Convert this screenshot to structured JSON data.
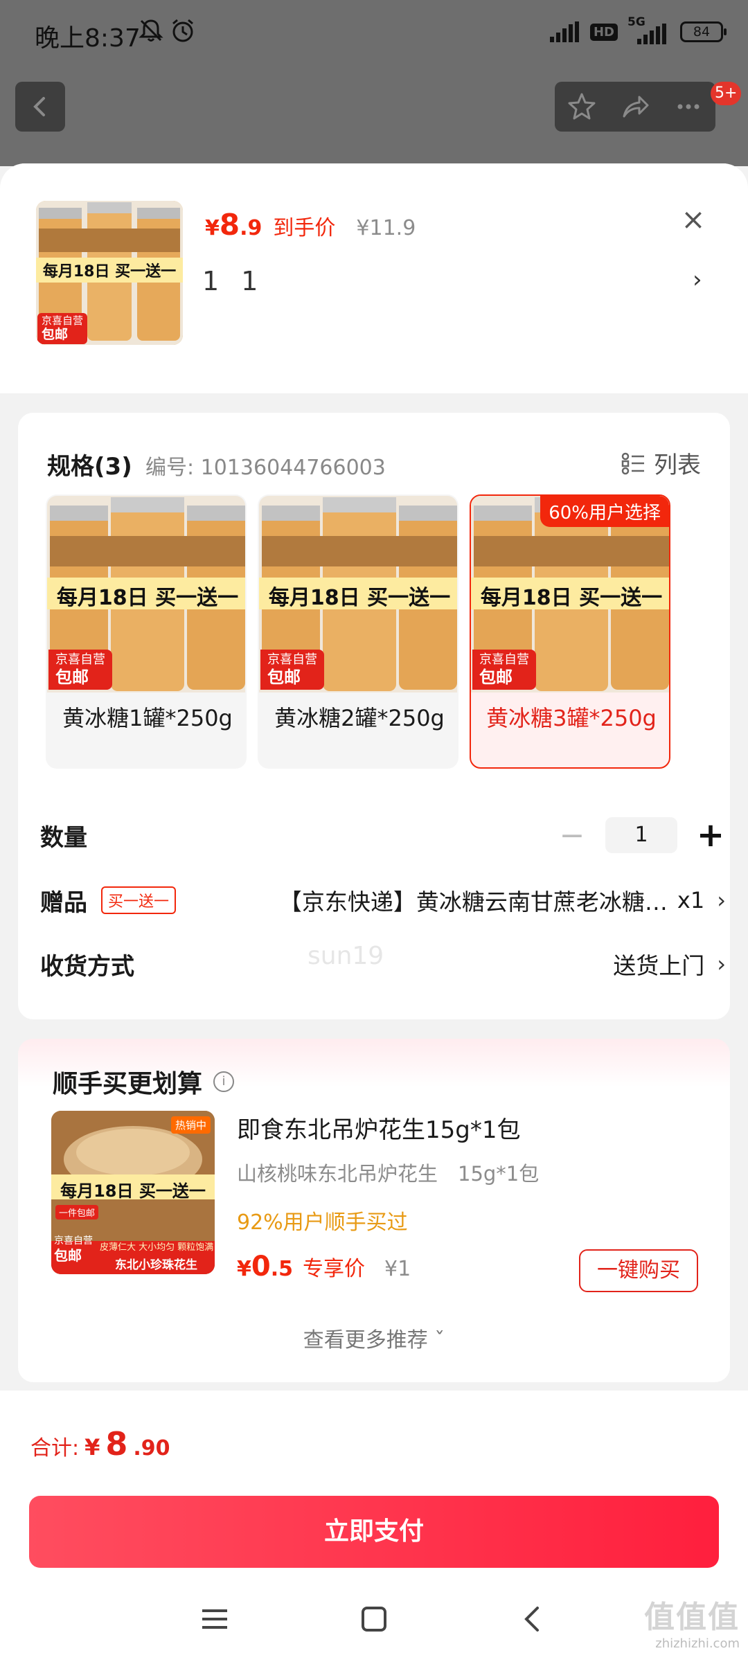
{
  "status_bar": {
    "time": "晚上8:37",
    "network": "5G",
    "hd": "HD",
    "battery": "84"
  },
  "nav": {
    "badge": "5+"
  },
  "product": {
    "currency": "¥",
    "price_int": "8",
    "price_dec": ".9",
    "price_tag": "到手价",
    "orig_price": "¥11.9",
    "selection_line": "1 1",
    "thumb_banner": "每月18日 买一送一",
    "thumb_tag1": "京喜自营",
    "thumb_tag2": "包邮"
  },
  "spec": {
    "title": "规格(3)",
    "code": "编号: 10136044766003",
    "list_label": "列表",
    "variants": [
      {
        "label": "黄冰糖1罐*250g",
        "banner": "每月18日 买一送一",
        "tag1": "京喜自营",
        "tag2": "包邮"
      },
      {
        "label": "黄冰糖2罐*250g",
        "banner": "每月18日 买一送一",
        "tag1": "京喜自营",
        "tag2": "包邮"
      },
      {
        "label": "黄冰糖3罐*250g",
        "banner": "每月18日 买一送一",
        "tag1": "京喜自营",
        "tag2": "包邮",
        "badge": "60%用户选择"
      }
    ]
  },
  "ghost_text": "sun19",
  "quantity": {
    "label": "数量",
    "minus": "−",
    "value": "1",
    "plus": "+"
  },
  "gift": {
    "label": "赠品",
    "tag": "买一送一",
    "value": "【京东快递】黄冰糖云南甘蔗老冰糖…",
    "count": "x1"
  },
  "delivery": {
    "label": "收货方式",
    "value": "送货上门"
  },
  "recommend": {
    "title": "顺手买更划算",
    "name": "即食东北吊炉花生15g*1包",
    "sub": "山核桃味东北吊炉花生　15g*1包",
    "rate": "92%用户顺手买过",
    "currency": "¥",
    "price_int": "0",
    "price_dec": ".5",
    "price_tag": "专享价",
    "orig_price": "¥1",
    "buy_label": "一键购买",
    "see_more": "查看更多推荐 ˇ",
    "img_banner": "每月18日 买一送一",
    "img_hot": "热销中",
    "img_tag1": "京喜自营",
    "img_tag2": "包邮",
    "img_caption": "东北小珍珠花生",
    "img_sub": "皮薄仁大 大小均匀 颗粒饱满",
    "img_stamp": "一件包邮"
  },
  "footer": {
    "total_label": "合计:",
    "currency": "¥",
    "total_int": "8",
    "total_dec": ".90",
    "pay_label": "立即支付"
  },
  "watermark": {
    "big": "值值值",
    "small": "zhizhizhi.com"
  },
  "colors": {
    "accent": "#f2270c",
    "pay_start": "#ff4d5f",
    "pay_end": "#ff1f3d",
    "rate": "#e89a14"
  }
}
